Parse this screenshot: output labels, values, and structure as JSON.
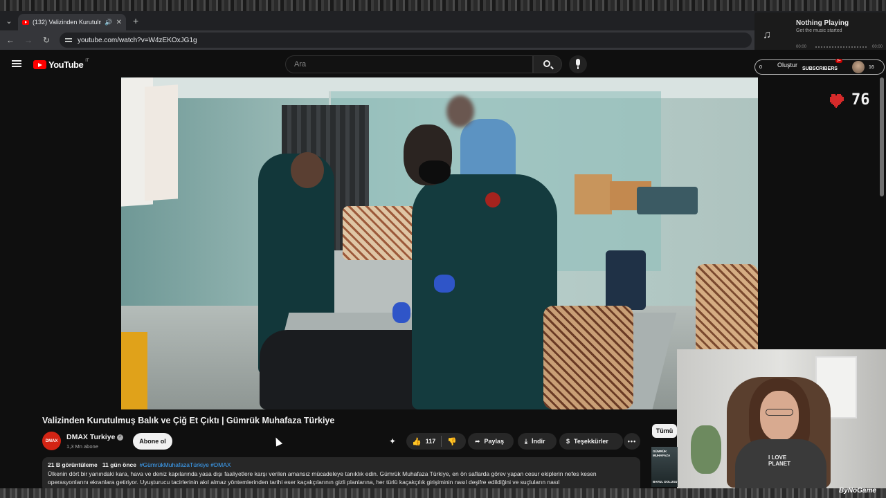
{
  "browser": {
    "tab_title": "(132) Valizinden Kurutulmu",
    "url": "youtube.com/watch?v=W4zEKOxJG1g"
  },
  "music_widget": {
    "title": "Nothing Playing",
    "subtitle": "Get the music started",
    "time_current": "00:00",
    "time_total": "00:00"
  },
  "youtube": {
    "logo_text": "YouTube",
    "logo_region": "IT",
    "search_placeholder": "Ara"
  },
  "stream_overlay": {
    "left_count": "0",
    "create_label": "Oluştur",
    "subscribers_label": "SUBSCRIBERS",
    "badge": "9+",
    "right_count": "16",
    "heart_count": "76",
    "heart_color": "#d62a2a",
    "webcam_shirt_text_line1": "I LOVE",
    "webcam_shirt_text_line2": "PLANET",
    "watermark": "ByNoGame"
  },
  "video": {
    "title": "Valizinden Kurutulmuş Balık ve Çiğ Et Çıktı | Gümrük Muhafaza Türkiye",
    "channel_name": "DMAX Turkiye",
    "channel_avatar_text": "DMAX",
    "channel_subs": "1,3 Mn abone",
    "subscribe_label": "Abone ol",
    "like_count": "117",
    "share_label": "Paylaş",
    "download_label": "İndir",
    "thanks_label": "Teşekkürler",
    "more_label": "•••",
    "views": "21 B görüntüleme",
    "age": "11 gün önce",
    "hashtags": "#GümrükMuhafazaTürkiye #DMAX",
    "description": "Ülkenin dört bir yanındaki kara, hava ve deniz kapılarında yasa dışı faaliyetlere karşı verilen amansız mücadeleye tanıklık edin. Gümrük Muhafaza Türkiye, en ön saflarda görev yapan cesur ekiplerin nefes kesen operasyonlarını ekranlara getiriyor. Uyuşturucu tacirlerinin akıl almaz yöntemlerinden tarihi eser kaçakçılarının gizli planlarına, her türlü kaçakçılık girişiminin nasıl deşifre edildiğini ve suçluların nasıl"
  },
  "sidebar": {
    "filter_chip": "Tümü",
    "thumb_text_1": "GÜMRÜK",
    "thumb_text_2": "MUHAFAZA",
    "thumb_text_3": "BAVUL DOLUSU"
  }
}
